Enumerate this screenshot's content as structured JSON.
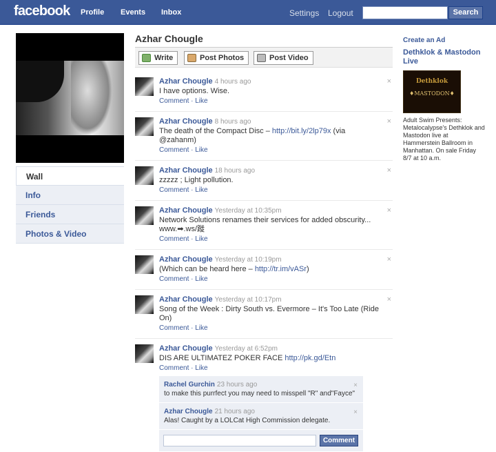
{
  "topbar": {
    "logo": "facebook",
    "nav": [
      "Profile",
      "Events",
      "Inbox"
    ],
    "settings": "Settings",
    "logout": "Logout",
    "search_value": "",
    "search_button": "Search"
  },
  "leftnav": {
    "items": [
      "Wall",
      "Info",
      "Friends",
      "Photos & Video"
    ],
    "active": "Wall"
  },
  "profile": {
    "name": "Azhar Chougle"
  },
  "composer": {
    "write": "Write",
    "post_photos": "Post Photos",
    "post_video": "Post Video"
  },
  "posts": [
    {
      "author": "Azhar Chougle",
      "time": "4 hours ago",
      "text": "I have options. Wise.",
      "link": "",
      "text_after": "",
      "actions": "Comment · Like"
    },
    {
      "author": "Azhar Chougle",
      "time": "8 hours ago",
      "text": "The death of the Compact Disc – ",
      "link": "http://bit.ly/2lp79x",
      "text_after": " (via @zahanm)",
      "actions": "Comment · Like"
    },
    {
      "author": "Azhar Chougle",
      "time": "18 hours ago",
      "text": "zzzzz ; Light pollution.",
      "link": "",
      "text_after": "",
      "actions": "Comment · Like"
    },
    {
      "author": "Azhar Chougle",
      "time": "Yesterday at 10:35pm",
      "text": "Network Solutions renames their services for added obscurity... www.➡.ws/蹝",
      "link": "",
      "text_after": "",
      "actions": "Comment · Like"
    },
    {
      "author": "Azhar Chougle",
      "time": "Yesterday at 10:19pm",
      "text": "(Which can be heard here – ",
      "link": "http://tr.im/vASr",
      "text_after": ")",
      "actions": "Comment · Like"
    },
    {
      "author": "Azhar Chougle",
      "time": "Yesterday at 10:17pm",
      "text": "Song of the Week : Dirty South vs. Evermore – It's Too Late (Ride On)",
      "link": "",
      "text_after": "",
      "actions": "Comment · Like"
    },
    {
      "author": "Azhar Chougle",
      "time": "Yesterday at 6:52pm",
      "text": "DIS ARE ULTIMATEZ POKER FACE ",
      "link": "http://pk.gd/Etn",
      "text_after": "",
      "actions": "Comment · Like"
    }
  ],
  "comments": [
    {
      "author": "Rachel Gurchin",
      "time": "23 hours ago",
      "text": "to make this purrfect you may need to misspell \"R\" and\"Fayce\""
    },
    {
      "author": "Azhar Chougle",
      "time": "21 hours ago",
      "text": "Alas! Caught by a LOLCat High Commission delegate."
    }
  ],
  "comment_box": {
    "value": "",
    "button": "Comment"
  },
  "right": {
    "create_ad": "Create an Ad",
    "ad_title": "Dethklok & Mastodon Live",
    "ad_image_line1": "Dethklok",
    "ad_image_line2": "♦MASTODON♦",
    "ad_text": "Adult Swim Presents: Metalocalypse's Dethklok and Mastodon live at Hammerstein Ballroom in Manhattan. On sale Friday 8/7 at 10 a.m."
  },
  "close_glyph": "×",
  "colors": {
    "brand": "#3b5998",
    "link": "#3b5998",
    "comment_bg": "#eceff5"
  }
}
